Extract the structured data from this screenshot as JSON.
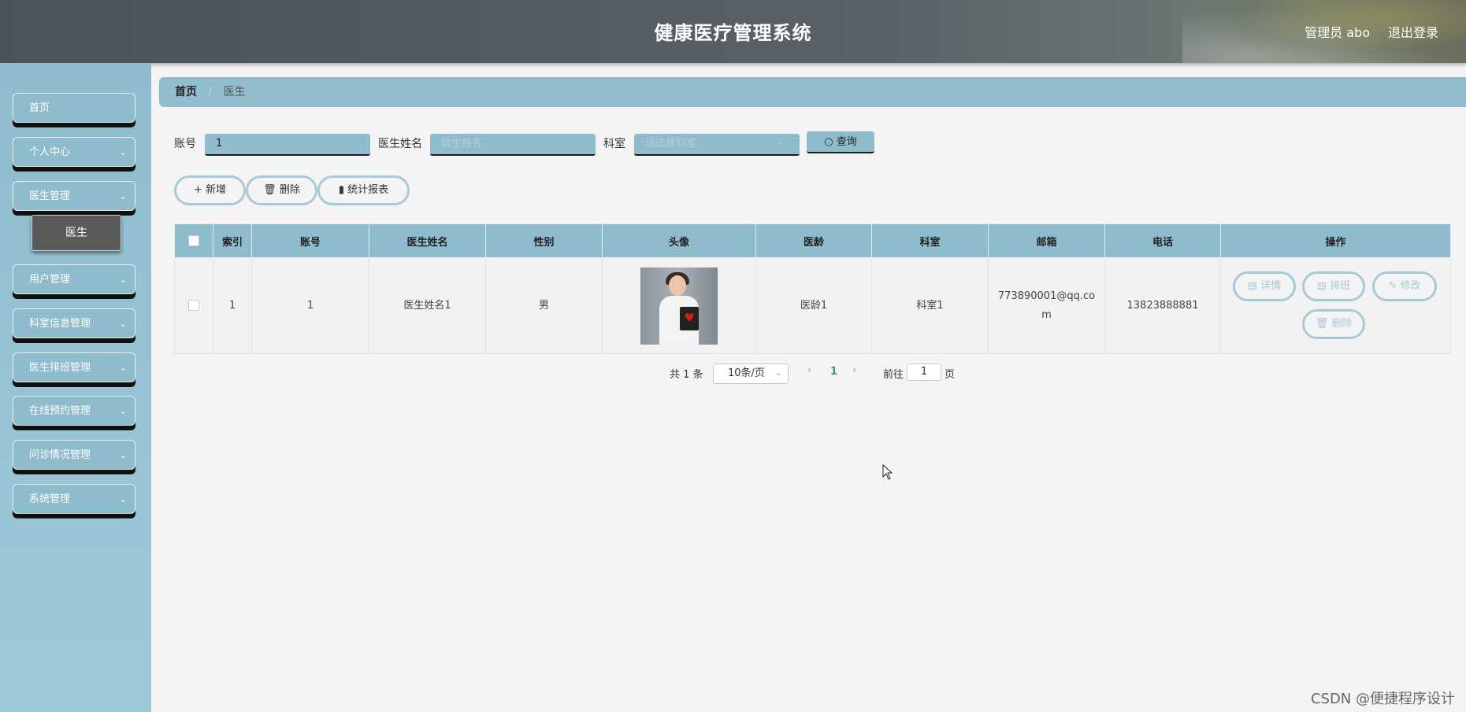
{
  "header": {
    "title": "健康医疗管理系统",
    "user": "管理员 abo",
    "logout": "退出登录"
  },
  "sidebar": {
    "items": [
      {
        "label": "首页",
        "chevron": false
      },
      {
        "label": "个人中心",
        "chevron": true
      },
      {
        "label": "医生管理",
        "chevron": true
      },
      {
        "label": "用户管理",
        "chevron": true
      },
      {
        "label": "科室信息管理",
        "chevron": true
      },
      {
        "label": "医生排班管理",
        "chevron": true
      },
      {
        "label": "在线预约管理",
        "chevron": true
      },
      {
        "label": "问诊情况管理",
        "chevron": true
      },
      {
        "label": "系统管理",
        "chevron": true
      }
    ],
    "active_sub": "医生"
  },
  "breadcrumb": {
    "home": "首页",
    "separator": "/",
    "current": "医生"
  },
  "search": {
    "account_label": "账号",
    "account_value": "1",
    "name_label": "医生姓名",
    "name_placeholder": "医生姓名",
    "dept_label": "科室",
    "dept_placeholder": "请选择科室",
    "query_button": "查询"
  },
  "actions": {
    "add": "新增",
    "delete": "删除",
    "report": "统计报表"
  },
  "table": {
    "columns": [
      "索引",
      "账号",
      "医生姓名",
      "性别",
      "头像",
      "医龄",
      "科室",
      "邮箱",
      "电话",
      "操作"
    ],
    "rows": [
      {
        "index": "1",
        "account": "1",
        "name": "医生姓名1",
        "gender": "男",
        "seniority": "医龄1",
        "dept": "科室1",
        "email": "773890001@qq.com",
        "phone": "13823888881"
      }
    ],
    "row_actions": {
      "detail": "详情",
      "schedule": "排班",
      "edit": "修改",
      "delete": "删除"
    }
  },
  "pagination": {
    "total": "共 1 条",
    "page_size": "10条/页",
    "current_page": "1",
    "goto_label": "前往",
    "goto_value": "1",
    "page_suffix": "页"
  },
  "watermark": "CSDN @便捷程序设计",
  "colors": {
    "accent": "#8fbccd",
    "outline": "#a9c9d5",
    "active_page": "#2f9e6a"
  }
}
